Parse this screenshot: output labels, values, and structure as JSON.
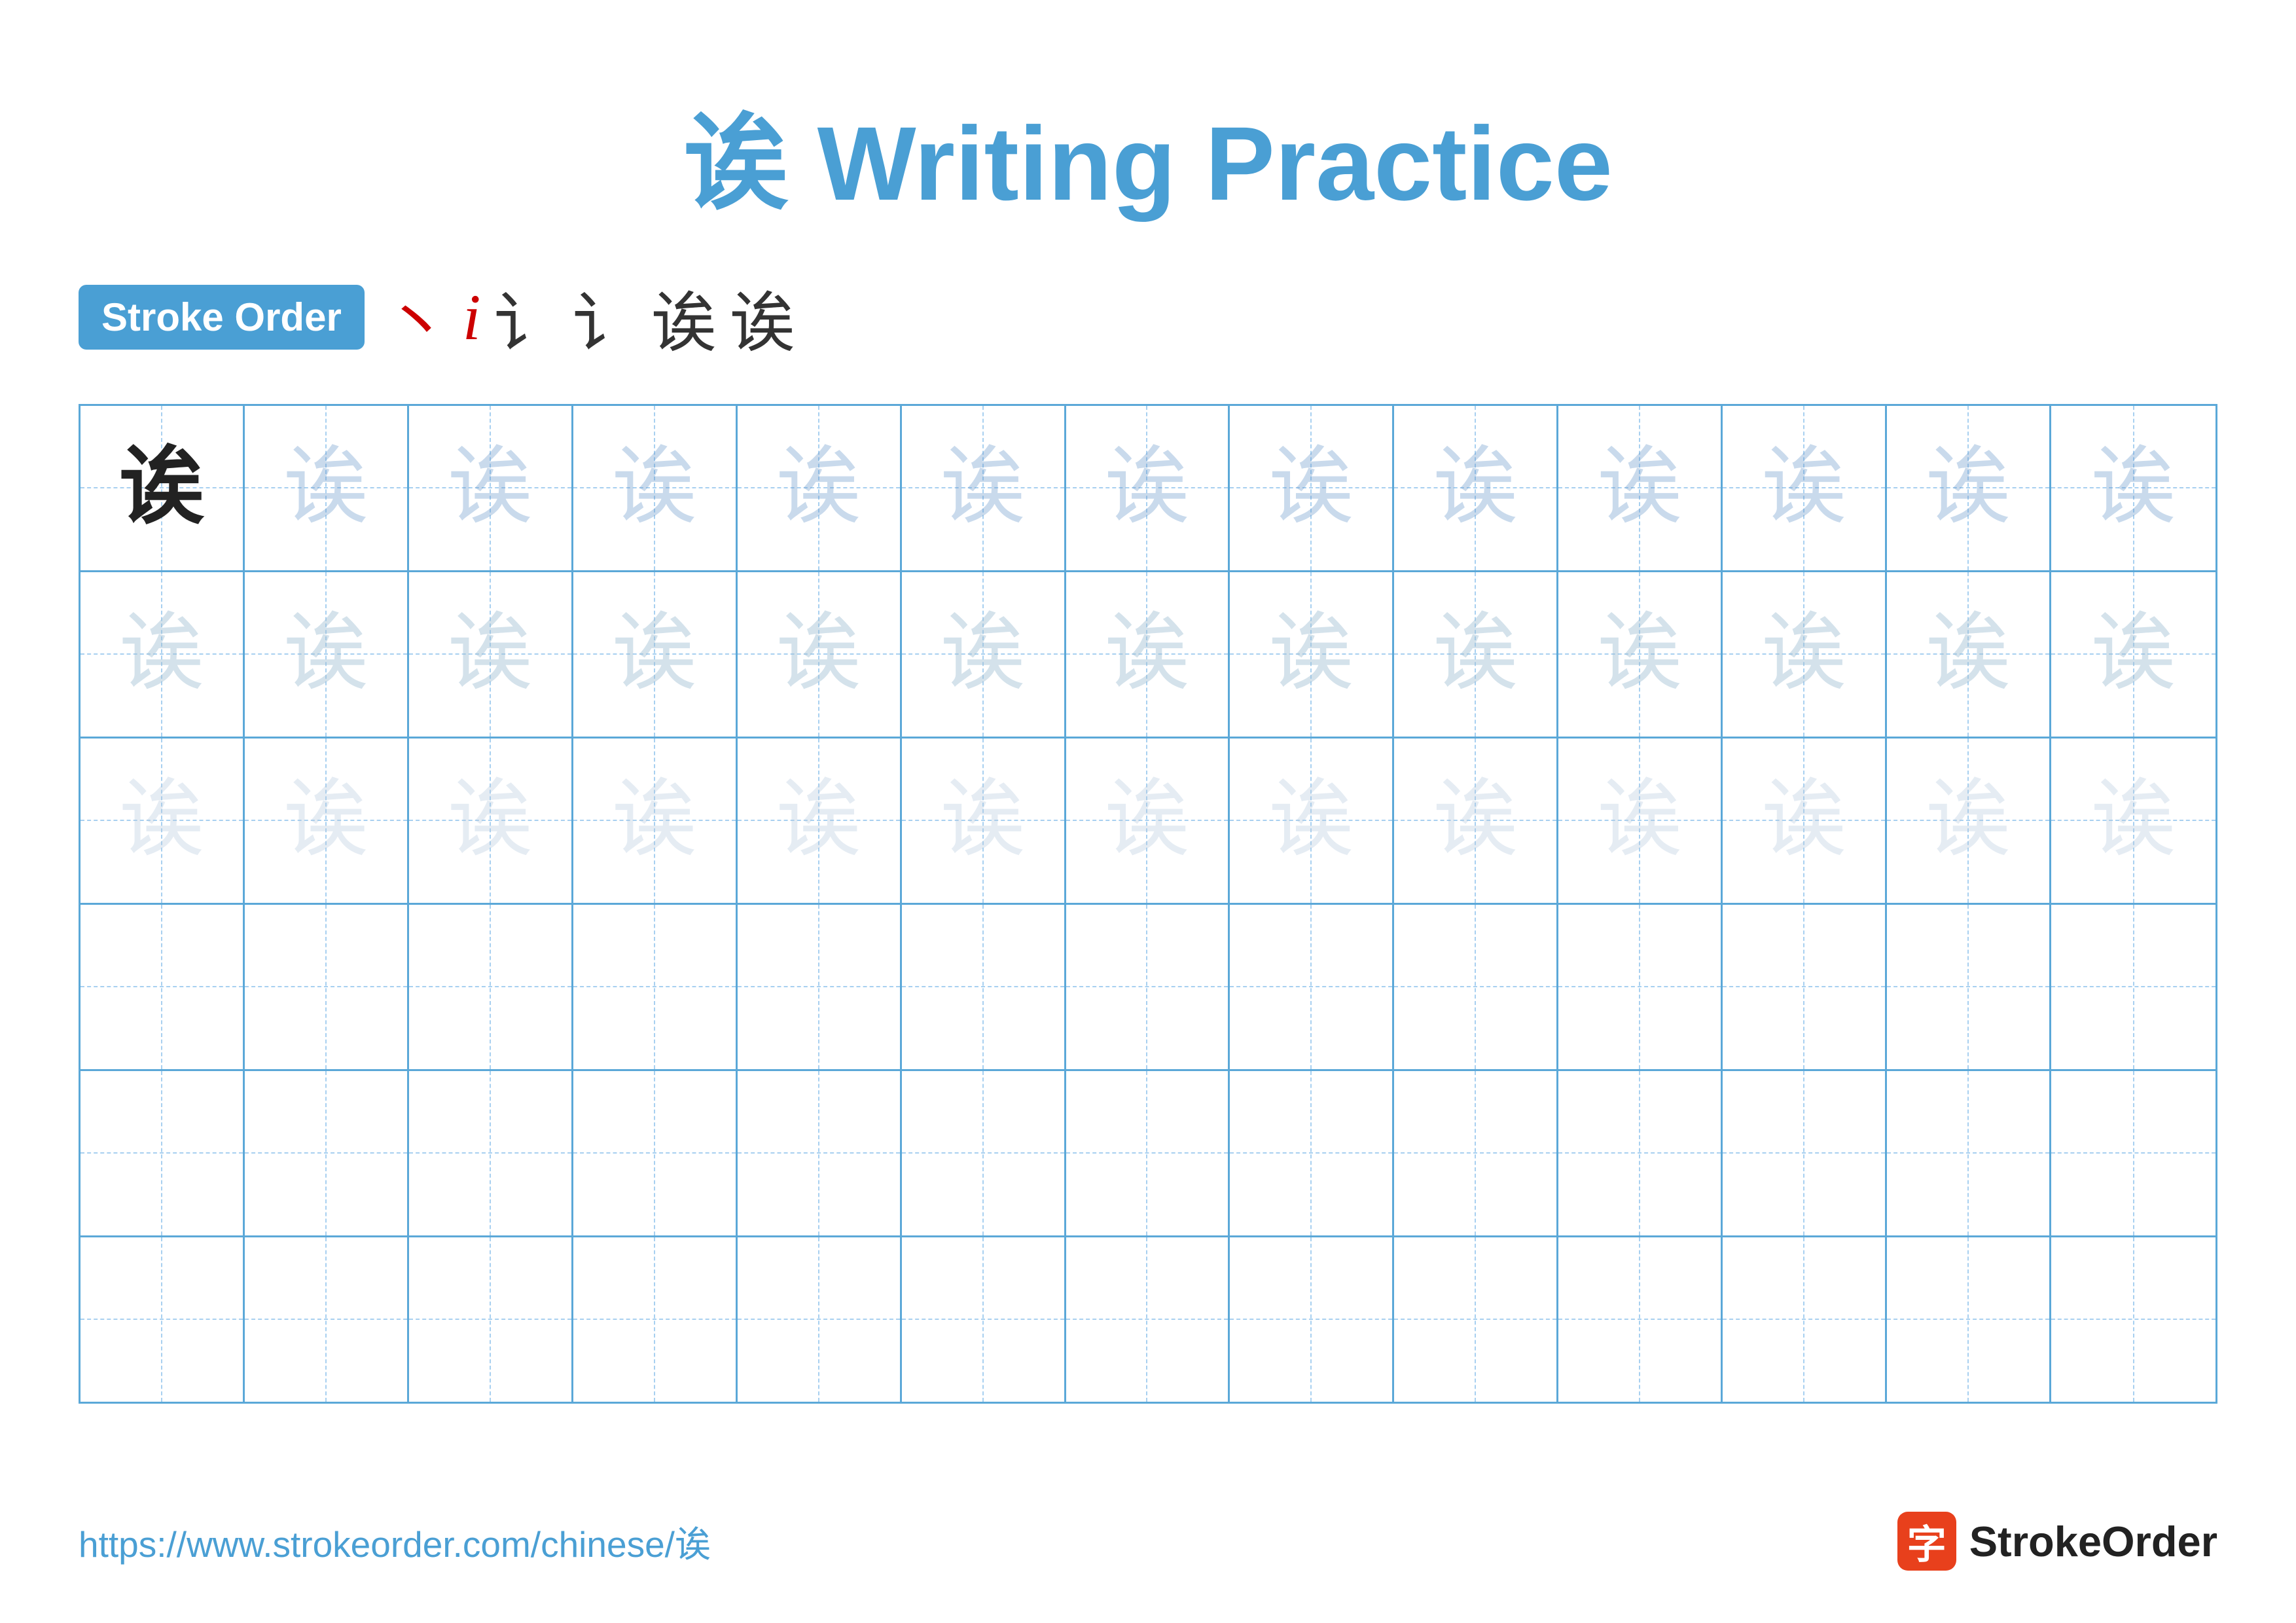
{
  "page": {
    "title": "诶 Writing Practice",
    "title_char": "诶",
    "title_suffix": "Writing Practice"
  },
  "stroke_order": {
    "badge_label": "Stroke Order",
    "strokes": [
      "、",
      "𝑖",
      "讠",
      "讠",
      "诶",
      "诶"
    ]
  },
  "grid": {
    "character": "诶",
    "rows": 6,
    "cols": 13,
    "row1_first_dark": true
  },
  "footer": {
    "url": "https://www.strokeorder.com/chinese/诶",
    "logo_char": "字",
    "logo_text": "StrokeOrder"
  }
}
